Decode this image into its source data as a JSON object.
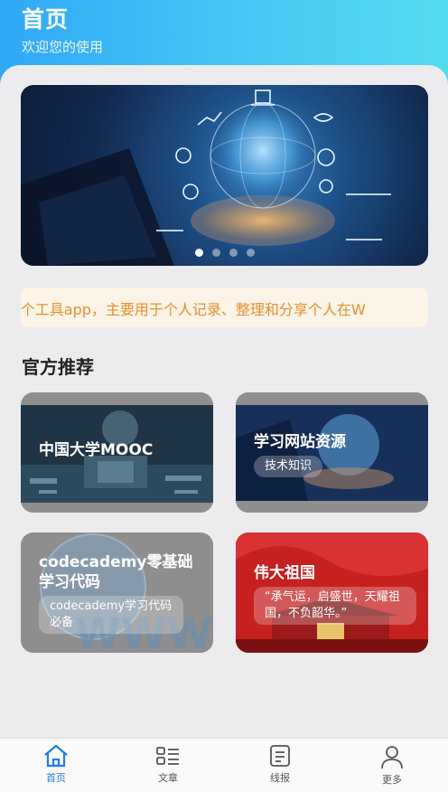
{
  "header": {
    "title": "首页",
    "subtitle": "欢迎您的使用"
  },
  "banner": {
    "dot_count": 4,
    "active_dot": 1
  },
  "notice": {
    "text": "-个工具app，主要用于个人记录、整理和分享个人在W"
  },
  "section": {
    "title": "官方推荐"
  },
  "cards": [
    {
      "title": "中国大学MOOC",
      "tag": ""
    },
    {
      "title": "学习网站资源",
      "tag": "技术知识"
    },
    {
      "title": "codecademy零基础学习代码",
      "tag": "codecademy学习代码必备"
    },
    {
      "title": "伟大祖国",
      "tag": "“承气运，启盛世，天耀祖国，不负韶华。”"
    }
  ],
  "tabbar": {
    "items": [
      {
        "label": "首页",
        "icon": "home-icon",
        "active": true
      },
      {
        "label": "文章",
        "icon": "article-list-icon",
        "active": false
      },
      {
        "label": "线报",
        "icon": "news-icon",
        "active": false
      },
      {
        "label": "更多",
        "icon": "user-icon",
        "active": false
      }
    ]
  },
  "colors": {
    "header_start": "#2fa8f6",
    "header_end": "#53dbf0",
    "notice_text": "#e88f2a",
    "notice_bg": "#fbf4e7",
    "active_tab": "#1e7ee8"
  }
}
